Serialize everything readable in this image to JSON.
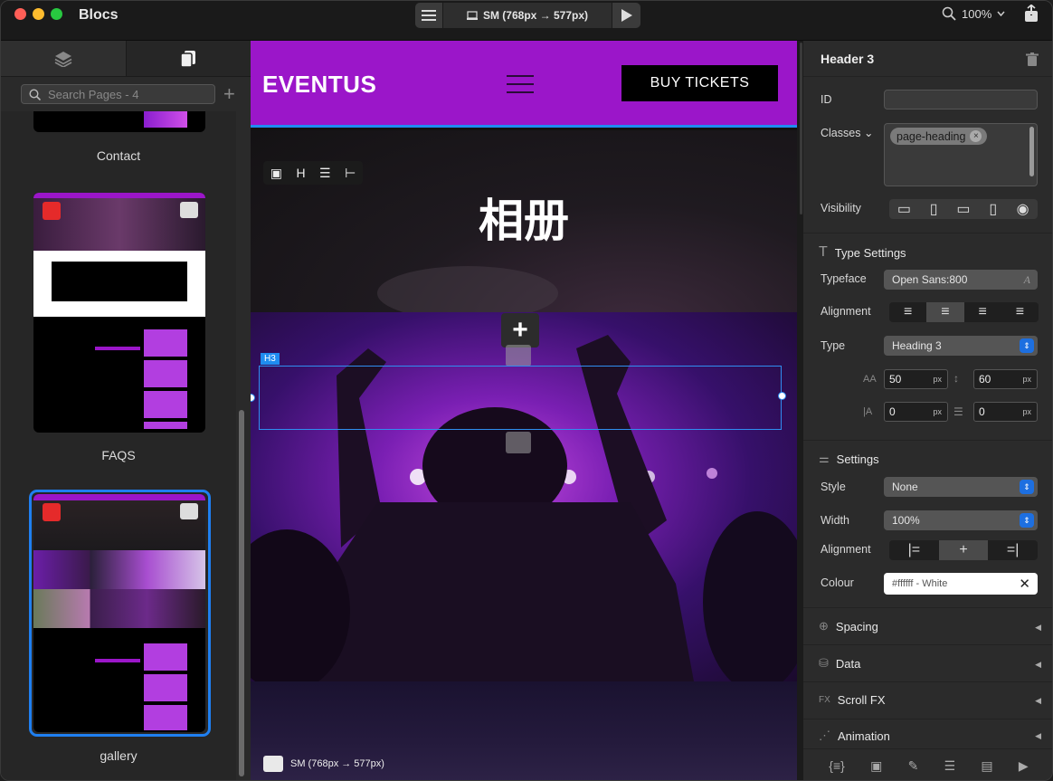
{
  "app": {
    "title": "Blocs"
  },
  "toolbar": {
    "breakpoint": "SM (768px → 577px)",
    "zoom": "100%"
  },
  "left_panel": {
    "search_placeholder": "Search Pages - 4",
    "pages": [
      {
        "label": "Contact"
      },
      {
        "label": "FAQS"
      },
      {
        "label": "gallery",
        "selected": true
      }
    ]
  },
  "site": {
    "brand": "EVENTUS",
    "buy_button": "BUY TICKETS",
    "hero_title": "相册",
    "h3_tag": "H3",
    "bottom_breakpoint": "SM (768px → 577px)",
    "accent": "#9b16c9"
  },
  "inspector": {
    "title": "Header 3",
    "id_label": "ID",
    "classes_label": "Classes",
    "class_tag": "page-heading",
    "visibility_label": "Visibility",
    "type_settings": "Type Settings",
    "typeface_label": "Typeface",
    "typeface_value": "Open Sans:800",
    "alignment_label": "Alignment",
    "type_label": "Type",
    "type_value": "Heading 3",
    "font_size": "50",
    "line_height": "60",
    "letter_spacing": "0",
    "word_spacing": "0",
    "unit": "px",
    "settings": "Settings",
    "style_label": "Style",
    "style_value": "None",
    "width_label": "Width",
    "width_value": "100%",
    "alignment2_label": "Alignment",
    "colour_label": "Colour",
    "colour_value": "#ffffff - White",
    "spacing": "Spacing",
    "data": "Data",
    "scroll_fx": "Scroll FX",
    "animation": "Animation"
  }
}
